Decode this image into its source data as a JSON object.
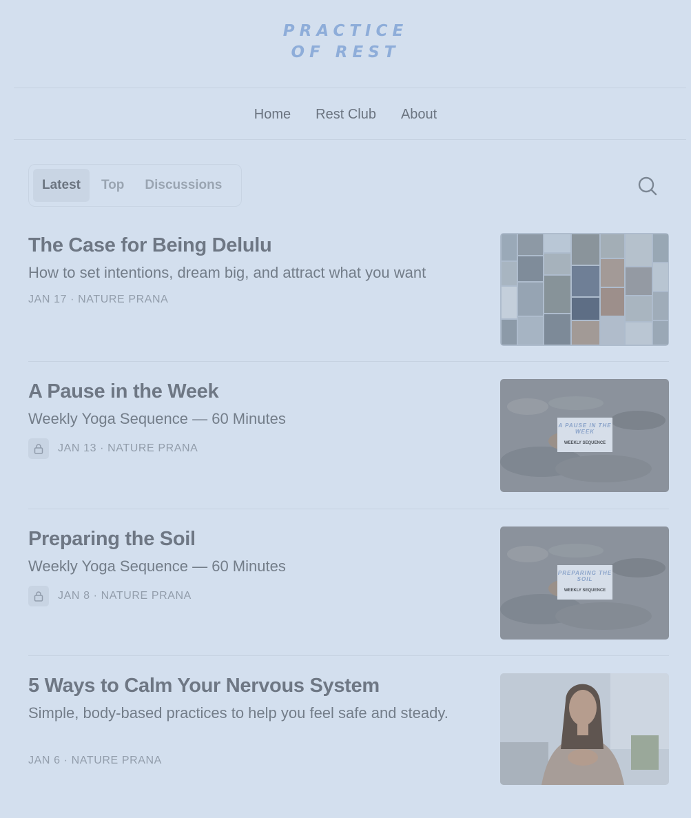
{
  "brand": {
    "line1": "PRACTICE",
    "line2": "OF REST",
    "color": "#8eadd9"
  },
  "nav": [
    "Home",
    "Rest Club",
    "About"
  ],
  "tabs": [
    {
      "label": "Latest",
      "active": true
    },
    {
      "label": "Top",
      "active": false
    },
    {
      "label": "Discussions",
      "active": false
    }
  ],
  "search_icon": "search-icon",
  "posts": [
    {
      "title": "The Case for Being Delulu",
      "subtitle": "How to set intentions, dream big, and attract what you want",
      "meta": "JAN 17 · NATURE PRANA",
      "locked": false,
      "thumbnail": "vision-board-collage"
    },
    {
      "title": "A Pause in the Week",
      "subtitle": "Weekly Yoga Sequence — 60 Minutes",
      "meta": "JAN 13 · NATURE PRANA",
      "locked": true,
      "thumbnail": "yoga-class-photo",
      "card_title": "A PAUSE IN THE WEEK",
      "card_caption": "WEEKLY SEQUENCE"
    },
    {
      "title": "Preparing the Soil",
      "subtitle": "Weekly Yoga Sequence — 60 Minutes",
      "meta": "JAN 8 · NATURE PRANA",
      "locked": true,
      "thumbnail": "yoga-class-photo",
      "card_title": "PREPARING THE SOIL",
      "card_caption": "WEEKLY SEQUENCE"
    },
    {
      "title": "5 Ways to Calm Your Nervous System",
      "subtitle": "Simple, body-based practices to help you feel safe and steady.",
      "meta": "JAN 6 · NATURE PRANA",
      "locked": false,
      "thumbnail": "woman-hand-on-chest-photo"
    }
  ]
}
